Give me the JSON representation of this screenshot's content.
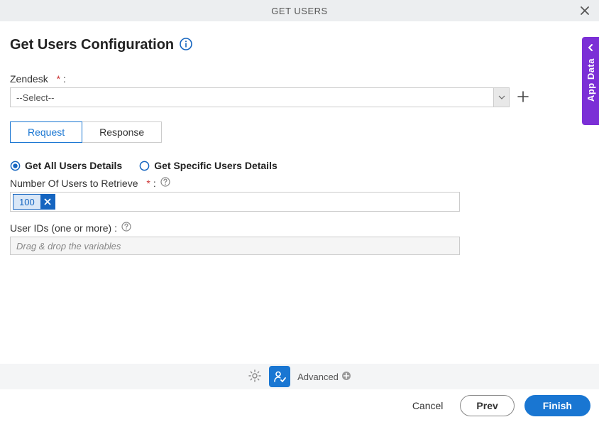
{
  "header": {
    "title": "GET USERS"
  },
  "page_title": "Get Users Configuration",
  "zendesk": {
    "label": "Zendesk",
    "required_marker": "*",
    "colon": ":",
    "selected": "--Select--"
  },
  "tabs": {
    "request": "Request",
    "response": "Response"
  },
  "radios": {
    "all": "Get All Users Details",
    "specific": "Get Specific Users Details"
  },
  "num_users": {
    "label": "Number Of Users to Retrieve",
    "required_marker": "*",
    "colon": ":",
    "value": "100"
  },
  "user_ids": {
    "label": "User IDs (one or more)",
    "colon": ":",
    "placeholder": "Drag & drop the variables"
  },
  "toolbar": {
    "advanced": "Advanced"
  },
  "footer": {
    "cancel": "Cancel",
    "prev": "Prev",
    "finish": "Finish"
  },
  "side_tab": "App Data"
}
